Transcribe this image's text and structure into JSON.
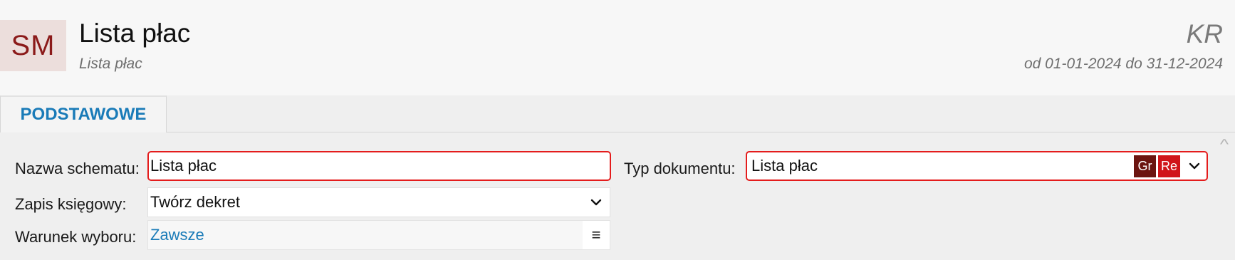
{
  "header": {
    "avatar_initials": "SM",
    "title": "Lista płac",
    "subtitle": "Lista płac",
    "company_code": "KR",
    "period": "od 01-01-2024 do 31-12-2024"
  },
  "tabs": [
    {
      "label": "PODSTAWOWE",
      "active": true
    }
  ],
  "form": {
    "nazwa_schematu": {
      "label": "Nazwa schematu:",
      "value": "Lista płac"
    },
    "zapis_ksiegowy": {
      "label": "Zapis księgowy:",
      "value": "Twórz dekret"
    },
    "warunek_wyboru": {
      "label": "Warunek wyboru:",
      "value": "Zawsze",
      "menu_icon": "≡"
    },
    "typ_dokumentu": {
      "label": "Typ dokumentu:",
      "value": "Lista płac",
      "badges": [
        {
          "text": "Gr",
          "color": "#6b1410"
        },
        {
          "text": "Re",
          "color": "#d0141a"
        }
      ]
    }
  },
  "colors": {
    "accent": "#1a7bb8",
    "required_border": "#e41c1c",
    "avatar_bg": "#ecdedc",
    "avatar_text": "#8b1a1a"
  }
}
